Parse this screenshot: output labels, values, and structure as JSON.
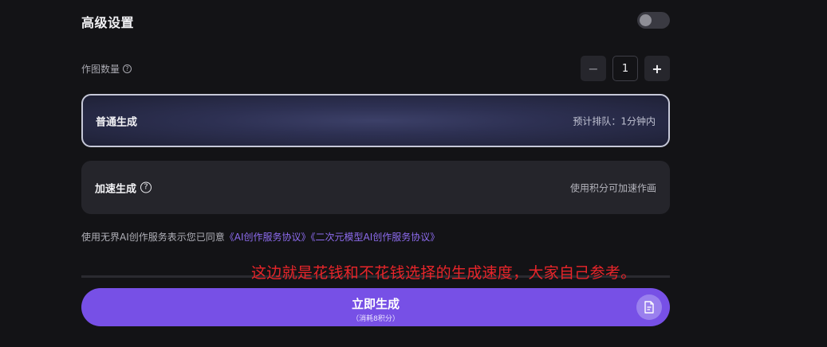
{
  "advanced": {
    "title": "高级设置",
    "toggle_on": false
  },
  "count": {
    "label": "作图数量",
    "help_icon": "question-circle-icon",
    "minus": "−",
    "value": "1",
    "plus": "+"
  },
  "options": {
    "normal": {
      "title": "普通生成",
      "note": "预计排队：1分钟内",
      "selected": true
    },
    "fast": {
      "title": "加速生成",
      "help_icon": "question-circle-icon",
      "note": "使用积分可加速作画"
    }
  },
  "agreement": {
    "prefix": "使用无界AI创作服务表示您已同意",
    "link1": "《AI创作服务协议》",
    "link2": "《二次元模型AI创作服务协议》"
  },
  "annotation": "这边就是花钱和不花钱选择的生成速度，大家自己参考。",
  "generate": {
    "label": "立即生成",
    "cost": "（消耗8积分）",
    "doc_icon": "document-icon"
  },
  "colors": {
    "accent": "#7750e6",
    "link": "#8e6cf0",
    "annotation": "#e8252a",
    "background": "#131316"
  }
}
